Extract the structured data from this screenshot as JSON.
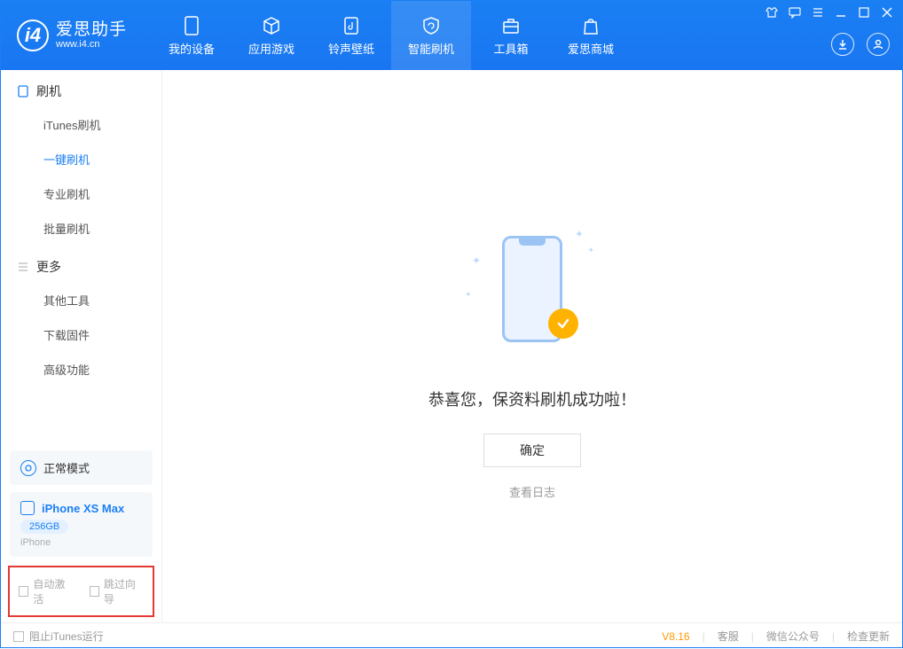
{
  "app": {
    "name": "爱思助手",
    "url": "www.i4.cn"
  },
  "tabs": [
    {
      "label": "我的设备"
    },
    {
      "label": "应用游戏"
    },
    {
      "label": "铃声壁纸"
    },
    {
      "label": "智能刷机"
    },
    {
      "label": "工具箱"
    },
    {
      "label": "爱思商城"
    }
  ],
  "sidebar": {
    "section1": {
      "title": "刷机",
      "items": [
        "iTunes刷机",
        "一键刷机",
        "专业刷机",
        "批量刷机"
      ]
    },
    "section2": {
      "title": "更多",
      "items": [
        "其他工具",
        "下载固件",
        "高级功能"
      ]
    }
  },
  "mode": {
    "label": "正常模式"
  },
  "device": {
    "name": "iPhone XS Max",
    "storage": "256GB",
    "type": "iPhone"
  },
  "options": {
    "auto_activate": "自动激活",
    "skip_wizard": "跳过向导"
  },
  "main": {
    "success": "恭喜您，保资料刷机成功啦！",
    "ok": "确定",
    "view_log": "查看日志"
  },
  "footer": {
    "block_itunes": "阻止iTunes运行",
    "version": "V8.16",
    "service": "客服",
    "wechat": "微信公众号",
    "update": "检查更新"
  }
}
